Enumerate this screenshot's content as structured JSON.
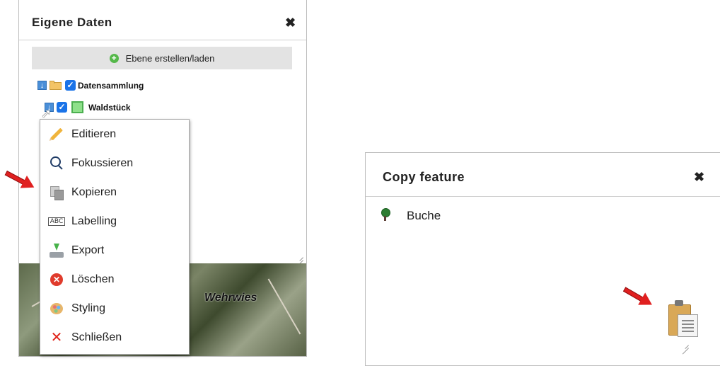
{
  "left_panel": {
    "title": "Eigene Daten",
    "close_glyph": "✖",
    "create_button_label": "Ebene erstellen/laden",
    "tree": {
      "folder_label": "Datensammlung",
      "layer_label": "Waldstück"
    },
    "map_label": "Wehrwies"
  },
  "context_menu": {
    "items": [
      {
        "label": "Editieren",
        "icon": "pencil-icon"
      },
      {
        "label": "Fokussieren",
        "icon": "magnifier-icon"
      },
      {
        "label": "Kopieren",
        "icon": "copy-icon"
      },
      {
        "label": "Labelling",
        "icon": "abc-label-icon"
      },
      {
        "label": "Export",
        "icon": "export-icon"
      },
      {
        "label": "Löschen",
        "icon": "delete-icon"
      },
      {
        "label": "Styling",
        "icon": "palette-icon"
      },
      {
        "label": "Schließen",
        "icon": "close-x-icon"
      }
    ]
  },
  "right_panel": {
    "title": "Copy feature",
    "close_glyph": "✖",
    "feature_label": "Buche",
    "paste_icon": "clipboard-icon"
  },
  "colors": {
    "annotation_arrow": "#e02020",
    "checkbox": "#1a73e8",
    "layer_color": "#8ee08a"
  }
}
